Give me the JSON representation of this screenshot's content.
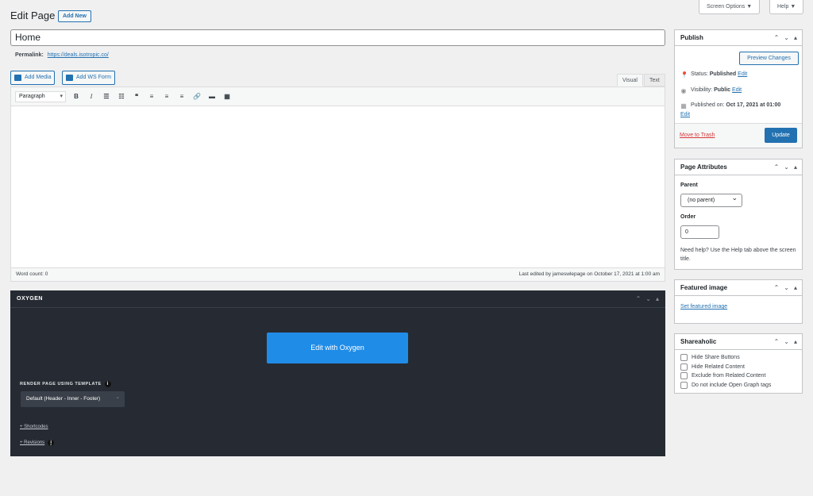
{
  "header": {
    "title": "Edit Page",
    "add_new": "Add New"
  },
  "top_tabs": {
    "screen_options": "Screen Options ▼",
    "help": "Help ▼"
  },
  "post": {
    "title": "Home",
    "permalink_label": "Permalink:",
    "permalink_url": "https://deals.isotropic.co/"
  },
  "media_buttons": {
    "add_media": "Add Media",
    "add_ws_form": "Add WS Form"
  },
  "editor_tabs": {
    "visual": "Visual",
    "text": "Text"
  },
  "toolbar": {
    "format": "Paragraph",
    "buttons": [
      "B",
      "I",
      "☰",
      "☷",
      "❝",
      "≡",
      "≡",
      "≡",
      "🔗",
      "▬",
      "▦"
    ]
  },
  "editor_status": {
    "word_count": "Word count: 0",
    "last_edited": "Last edited by jameswlepage on October 17, 2021 at 1:00 am"
  },
  "oxygen": {
    "title": "OXYGEN",
    "edit_button": "Edit with Oxygen",
    "template_label": "RENDER PAGE USING TEMPLATE",
    "template_value": "Default (Header - Inner - Footer)",
    "shortcodes": "+ Shortcodes",
    "revisions": "+ Revisions",
    "info": "i"
  },
  "publish": {
    "title": "Publish",
    "preview": "Preview Changes",
    "status_label": "Status:",
    "status_value": "Published",
    "visibility_label": "Visibility:",
    "visibility_value": "Public",
    "published_label": "Published on:",
    "published_value": "Oct 17, 2021 at 01:00",
    "edit": "Edit",
    "trash": "Move to Trash",
    "update": "Update"
  },
  "page_attributes": {
    "title": "Page Attributes",
    "parent_label": "Parent",
    "parent_value": "(no parent)",
    "order_label": "Order",
    "order_value": "0",
    "help": "Need help? Use the Help tab above the screen title."
  },
  "featured_image": {
    "title": "Featured image",
    "link": "Set featured image"
  },
  "shareaholic": {
    "title": "Shareaholic",
    "options": [
      "Hide Share Buttons",
      "Hide Related Content",
      "Exclude from Related Content",
      "Do not include Open Graph tags"
    ]
  },
  "box_controls": {
    "up": "⌃",
    "down": "⌄",
    "toggle": "▴"
  },
  "colors": {
    "accent": "#2271b1",
    "oxygen_bg": "#262b33",
    "oxygen_button": "#1f8ce8",
    "danger": "#d63638"
  }
}
